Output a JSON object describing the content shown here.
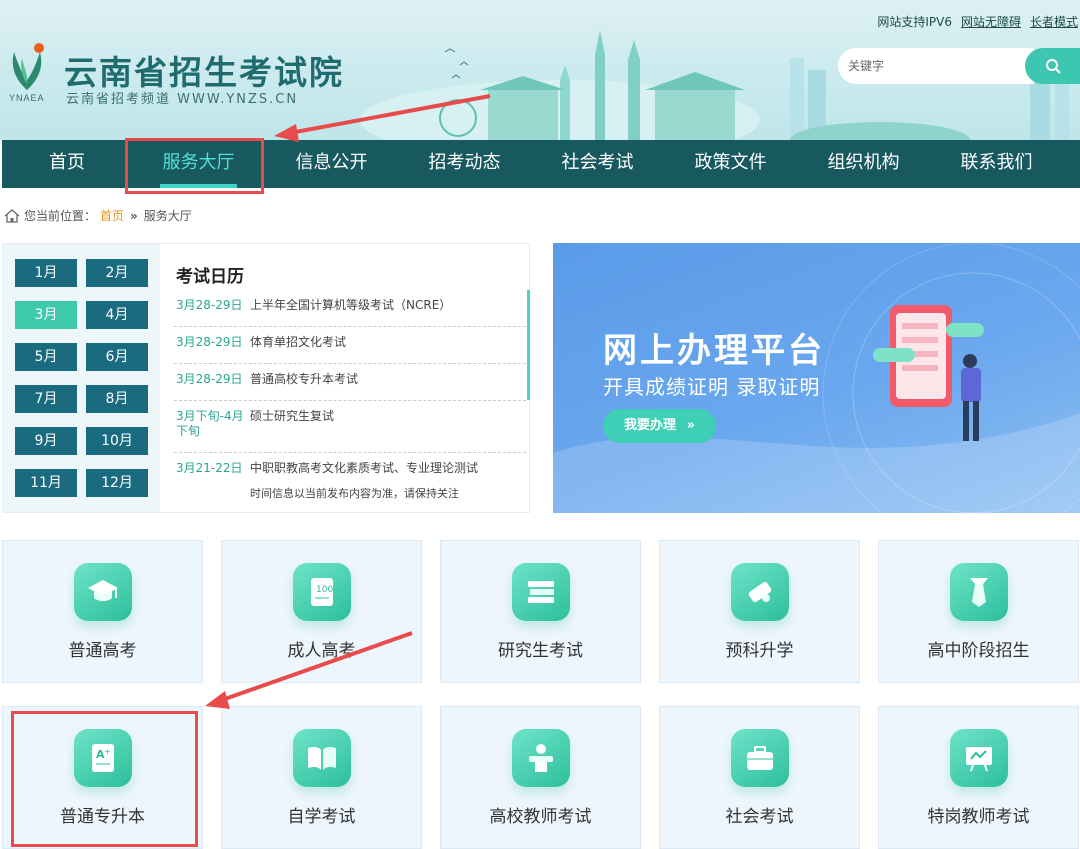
{
  "header": {
    "site_title": "云南省招生考试院",
    "site_subtitle": "云南省招考频道 WWW.YNZS.CN",
    "logo_text": "YNAEA",
    "top_links": [
      "网站支持IPV6",
      "网站无障碍",
      "长者模式"
    ],
    "search_placeholder": "关键字"
  },
  "nav": {
    "items": [
      "首页",
      "服务大厅",
      "信息公开",
      "招考动态",
      "社会考试",
      "政策文件",
      "组织机构",
      "联系我们"
    ],
    "active_index": 1
  },
  "breadcrumb": {
    "prefix": "您当前位置：",
    "home": "首页",
    "separator": "»",
    "current": "服务大厅"
  },
  "calendar": {
    "title": "考试日历",
    "months": [
      "1月",
      "2月",
      "3月",
      "4月",
      "5月",
      "6月",
      "7月",
      "8月",
      "9月",
      "10月",
      "11月",
      "12月"
    ],
    "active_month": "3月",
    "events": [
      {
        "date": "3月28-29日",
        "name": "上半年全国计算机等级考试（NCRE）"
      },
      {
        "date": "3月28-29日",
        "name": "体育单招文化考试"
      },
      {
        "date": "3月28-29日",
        "name": "普通高校专升本考试"
      },
      {
        "date": "3月下旬-4月下旬",
        "name": "硕士研究生复试"
      },
      {
        "date": "3月21-22日",
        "name": "中职职教高考文化素质考试、专业理论测试"
      }
    ],
    "note": "时间信息以当前发布内容为准，请保持关注"
  },
  "promo": {
    "title": "网上办理平台",
    "subtitle": "开具成绩证明 录取证明",
    "button": "我要办理"
  },
  "services": [
    {
      "label": "普通高考",
      "icon": "graduation-cap-icon"
    },
    {
      "label": "成人高考",
      "icon": "certificate-scroll-icon"
    },
    {
      "label": "研究生考试",
      "icon": "book-stack-icon"
    },
    {
      "label": "预科升学",
      "icon": "diploma-icon"
    },
    {
      "label": "高中阶段招生",
      "icon": "necktie-icon"
    },
    {
      "label": "普通专升本",
      "icon": "exam-paper-icon"
    },
    {
      "label": "自学考试",
      "icon": "open-book-icon"
    },
    {
      "label": "高校教师考试",
      "icon": "podium-teacher-icon"
    },
    {
      "label": "社会考试",
      "icon": "briefcase-icon"
    },
    {
      "label": "特岗教师考试",
      "icon": "blackboard-icon"
    }
  ],
  "colors": {
    "nav_bg": "#17595f",
    "accent": "#3ec9ad",
    "month_bg": "#1a6b80",
    "highlight_red": "#e84b4b",
    "promo_blue": "#5a9be8"
  }
}
